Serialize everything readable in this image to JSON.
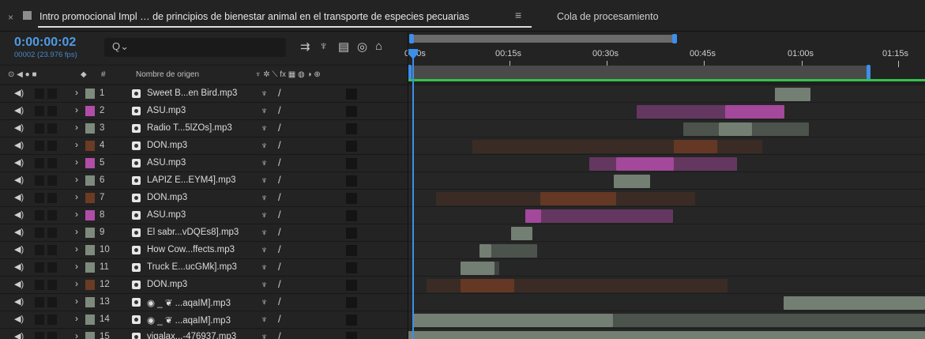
{
  "tab": {
    "close": "×",
    "title": "Intro promocional Impl … de principios de bienestar animal en el transporte de especies pecuarias",
    "menu": "≡",
    "queue": "Cola de procesamiento"
  },
  "header": {
    "timecode": "0:00:00:02",
    "frames": "00002 (23.976 fps)",
    "search_icon": "Q⌄"
  },
  "columns": {
    "number": "#",
    "source_name": "Nombre de origen",
    "switches": "♆ ✲ ⟍ fx ▦ ◍ ◑ ⊕"
  },
  "ruler": {
    "ticks": [
      "0:00s",
      "00:15s",
      "00:30s",
      "00:45s",
      "01:00s",
      "01:15s"
    ]
  },
  "colors": {
    "accent": "#3d8fea",
    "timecode": "#4f9be6",
    "green": "#33c34a",
    "label_gray": "#7d8a7d",
    "label_pink": "#b14da8",
    "label_brown": "#6b3b25"
  },
  "layers": [
    {
      "num": "1",
      "name": "Sweet B...en Bird.mp3",
      "label": "#7d8a7d"
    },
    {
      "num": "2",
      "name": "ASU.mp3",
      "label": "#b14da8"
    },
    {
      "num": "3",
      "name": "Radio T...5lZOs].mp3",
      "label": "#7d8a7d"
    },
    {
      "num": "4",
      "name": "DON.mp3",
      "label": "#6b3b25"
    },
    {
      "num": "5",
      "name": "ASU.mp3",
      "label": "#b14da8"
    },
    {
      "num": "6",
      "name": "LAPIZ E...EYM4].mp3",
      "label": "#7d8a7d"
    },
    {
      "num": "7",
      "name": "DON.mp3",
      "label": "#6b3b25"
    },
    {
      "num": "8",
      "name": "ASU.mp3",
      "label": "#b14da8"
    },
    {
      "num": "9",
      "name": "El sabr...vDQEs8].mp3",
      "label": "#7d8a7d"
    },
    {
      "num": "10",
      "name": "How Cow...ffects.mp3",
      "label": "#7d8a7d"
    },
    {
      "num": "11",
      "name": "Truck E...ucGMk].mp3",
      "label": "#7d8a7d"
    },
    {
      "num": "12",
      "name": "DON.mp3",
      "label": "#6b3b25"
    },
    {
      "num": "13",
      "name": "◉ _ ❦ ...aqaIM].mp3",
      "label": "#7d8a7d"
    },
    {
      "num": "14",
      "name": "◉ _ ❦ ...aqaIM].mp3",
      "label": "#7d8a7d"
    },
    {
      "num": "15",
      "name": "vjgalax...-476937.mp3",
      "label": "#7d8a7d"
    }
  ]
}
